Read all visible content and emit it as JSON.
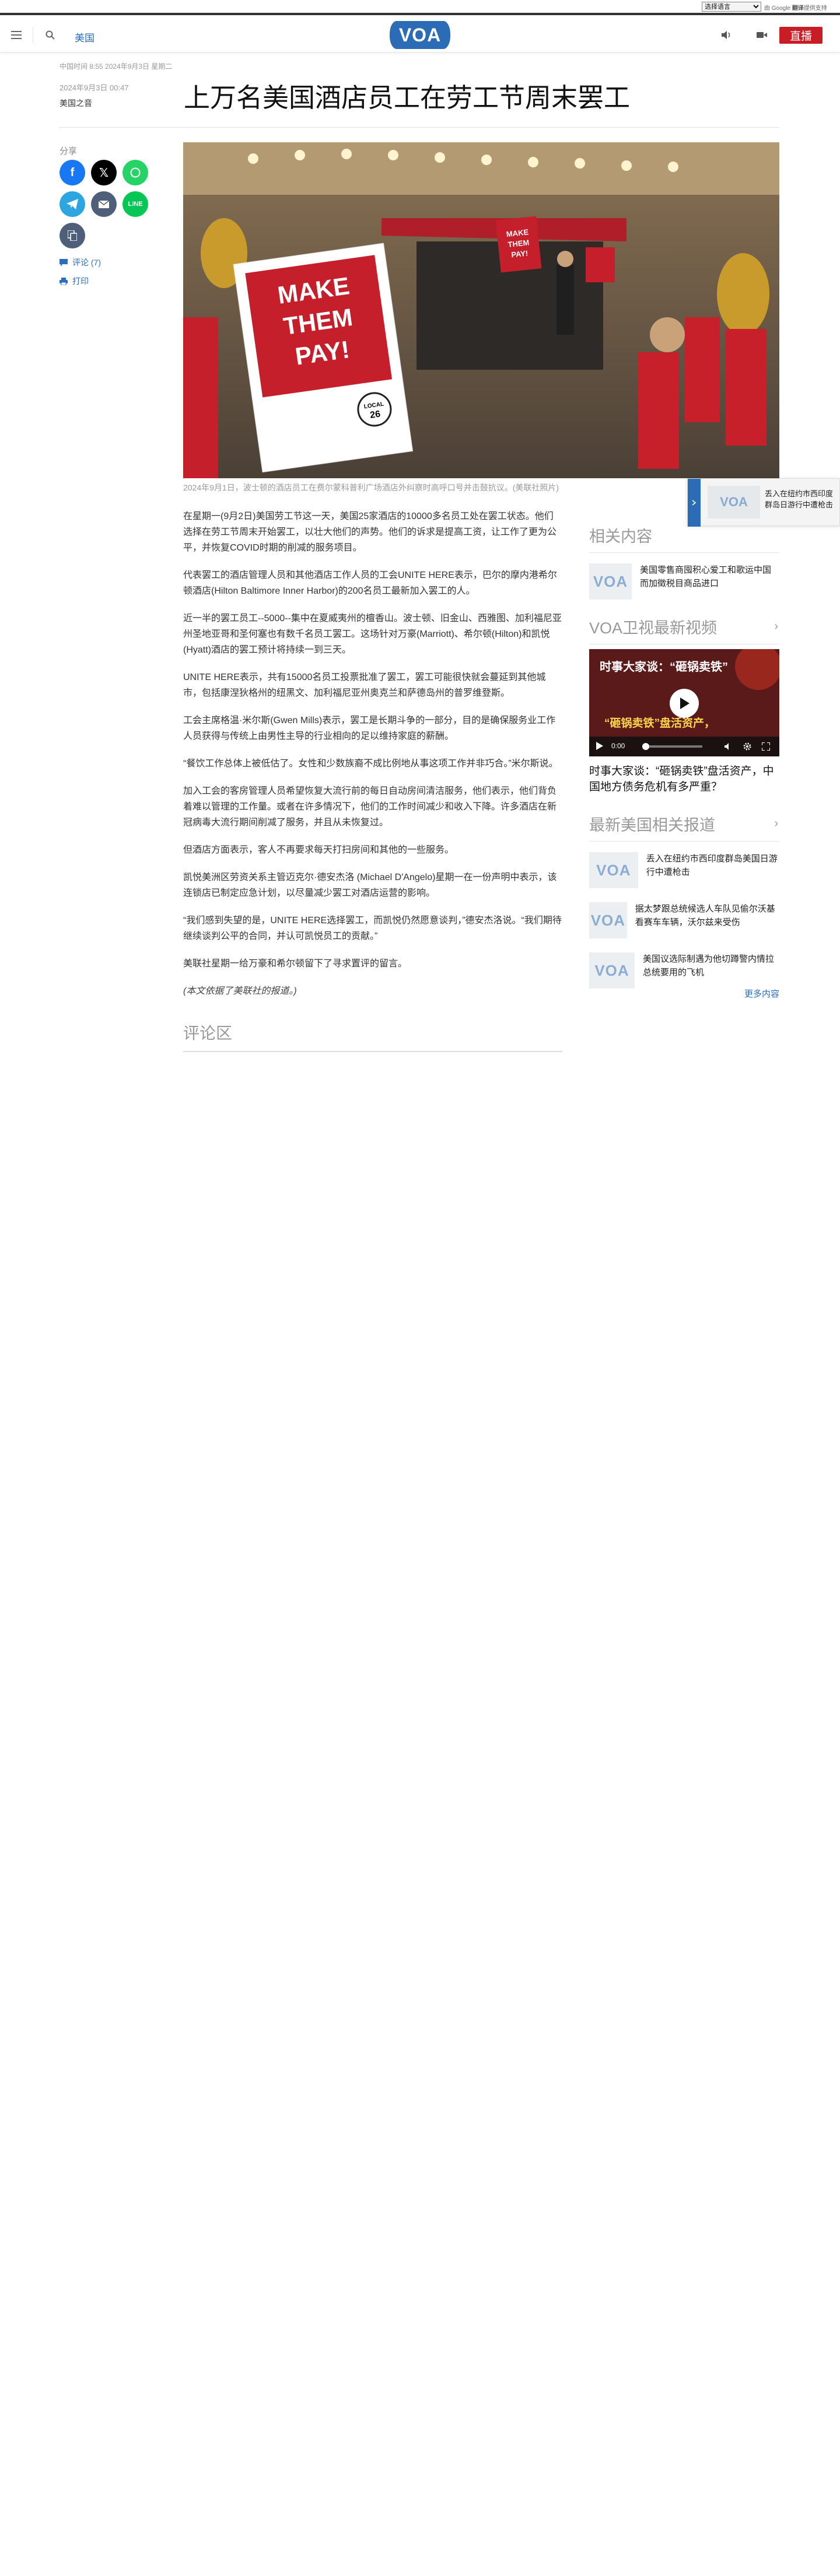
{
  "translate": {
    "select_label": "选择语言",
    "powered": "由 Google",
    "powered_brand": "翻译",
    "powered_suffix": "提供支持"
  },
  "header": {
    "nav_label": "美国",
    "logo_text": "VOA",
    "live_label": "直播"
  },
  "article": {
    "published": "中国时间 8:55 2024年9月3日 星期二",
    "date": "2024年9月3日 00:47",
    "byline": "美国之音",
    "title": "上万名美国酒店员工在劳工节周末罢工",
    "share_label": "分享",
    "comments_label": "评论 (7)",
    "print_label": "打印",
    "hero": {
      "sign_text": "MAKE THEM PAY!",
      "local": "LOCAL",
      "local_num": "26",
      "small_sign": "MAKE THEM PAY!"
    },
    "caption": "2024年9月1日，波士顿的酒店员工在费尔蒙科普利广场酒店外纠察时高呼口号并击鼓抗议。(美联社照片)",
    "paragraphs": [
      "在星期一(9月2日)美国劳工节这一天，美国25家酒店的10000多名员工处在罢工状态。他们选择在劳工节周末开始罢工，以壮大他们的声势。他们的诉求是提高工资，让工作了更为公平，并恢复COVID时期的削减的服务项目。",
      "代表罢工的酒店管理人员和其他酒店工作人员的工会UNITE HERE表示，巴尔的摩内港希尔顿酒店(Hilton Baltimore Inner Harbor)的200名员工最新加入罢工的人。",
      "近一半的罢工员工--5000--集中在夏威夷州的檀香山。波士顿、旧金山、西雅图、加利福尼亚州圣地亚哥和圣何塞也有数千名员工罢工。这场针对万豪(Marriott)、希尔顿(Hilton)和凯悦(Hyatt)酒店的罢工预计将持续一到三天。",
      "UNITE HERE表示，共有15000名员工投票批准了罢工，罢工可能很快就会蔓延到其他城市，包括康涅狄格州的纽黑文、加利福尼亚州奥克兰和萨德岛州的普罗维登斯。",
      "工会主席格温·米尔斯(Gwen Mills)表示，罢工是长期斗争的一部分，目的是确保服务业工作人员获得与传统上由男性主导的行业相向的足以维持家庭的薪酬。",
      "“餐饮工作总体上被低估了。女性和少数族裔不成比例地从事这项工作并非巧合。”米尔斯说。",
      "加入工会的客房管理人员希望恢复大流行前的每日自动房间清洁服务，他们表示，他们背负着难以管理的工作量。或者在许多情况下，他们的工作时间减少和收入下降。许多酒店在新冠病毒大流行期间削减了服务，并且从未恢复过。",
      "但酒店方面表示，客人不再要求每天打扫房间和其他的一些服务。",
      "凯悦美洲区劳资关系主管迈克尔·德安杰洛 (Michael D'Angelo)星期一在一份声明中表示，该连锁店已制定应急计划，以尽量减少罢工对酒店运营的影响。",
      "“我们感到失望的是，UNITE HERE选择罢工，而凯悦仍然愿意谈判，”德安杰洛说。“我们期待继续谈判公平的合同，并认可凯悦员工的贡献。”",
      "美联社星期一给万豪和希尔顿留下了寻求置评的留言。"
    ],
    "footnote": "(本文依据了美联社的报道。)",
    "comments_title": "评论区"
  },
  "sidebar": {
    "related_title": "相关内容",
    "related": [
      {
        "text": "美国零售商囤积心爱工和歌运中国而加徵税目商品进口"
      }
    ],
    "video_title": "VOA卫视最新视频",
    "video": {
      "overlay_title": "时事大家谈：“砸锅卖铁”",
      "overlay_banner": "“砸锅卖铁”盘活资产，",
      "time": "0:00",
      "caption": "时事大家谈：“砸锅卖铁”盘活资产，中国地方债务危机有多严重？"
    },
    "latest_title": "最新美国相关报道",
    "latest": [
      {
        "text": "丢入在纽约市西印度群岛美国日游行中遭枪击"
      },
      {
        "text": "据太梦跟总统候选人车队见偷尔沃基看赛车车辆，沃尔兹来受伤"
      },
      {
        "text": "美国议选际制遇为他切蹲警内情拉总统要用的飞机"
      }
    ],
    "more_label": "更多内容"
  },
  "popup": {
    "text": "丢入在纽约市西印度群岛日游行中遭枪击"
  }
}
